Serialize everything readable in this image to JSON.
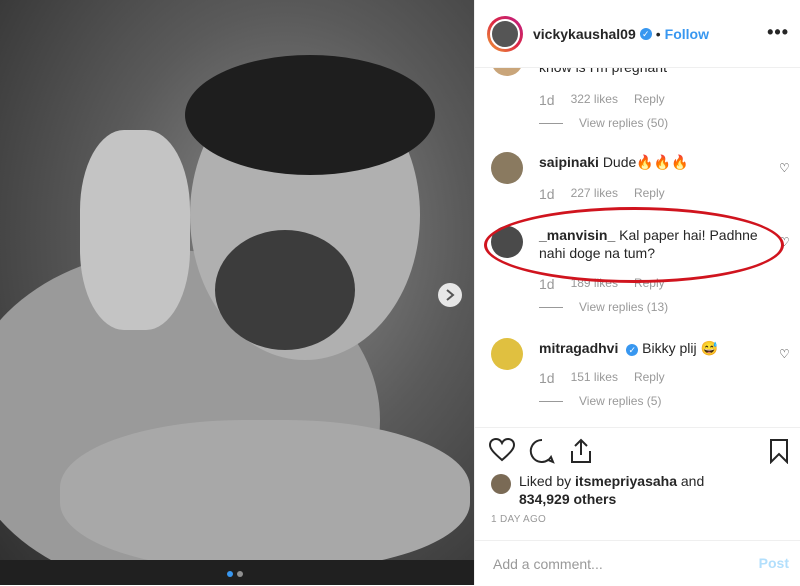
{
  "post": {
    "username": "vickykaushal09",
    "separator": "•",
    "follow_label": "Follow",
    "more_label": "•••"
  },
  "comments": [
    {
      "user": "",
      "text": "know is I'm pregnant",
      "age": "1d",
      "likes": "322 likes",
      "reply": "Reply",
      "view_replies": "View replies (50)"
    },
    {
      "user": "saipinaki",
      "text": "Dude🔥🔥🔥",
      "age": "1d",
      "likes": "227 likes",
      "reply": "Reply"
    },
    {
      "user": "_manvisin_",
      "text": "Kal paper hai! Padhne nahi doge na tum?",
      "age": "1d",
      "likes": "189 likes",
      "reply": "Reply",
      "view_replies": "View replies (13)"
    },
    {
      "user": "mitragadhvi",
      "text": "Bikky plij 😅",
      "age": "1d",
      "likes": "151 likes",
      "reply": "Reply",
      "view_replies": "View replies (5)"
    }
  ],
  "likes": {
    "prefix": "Liked by",
    "user": "itsmepriyasaha",
    "and": "and",
    "count": "834,929 others"
  },
  "date": "1 DAY AGO",
  "add_comment": {
    "placeholder": "Add a comment...",
    "post_label": "Post"
  },
  "colors": {
    "accent": "#3897f0",
    "highlight_oval": "#d0141e"
  }
}
